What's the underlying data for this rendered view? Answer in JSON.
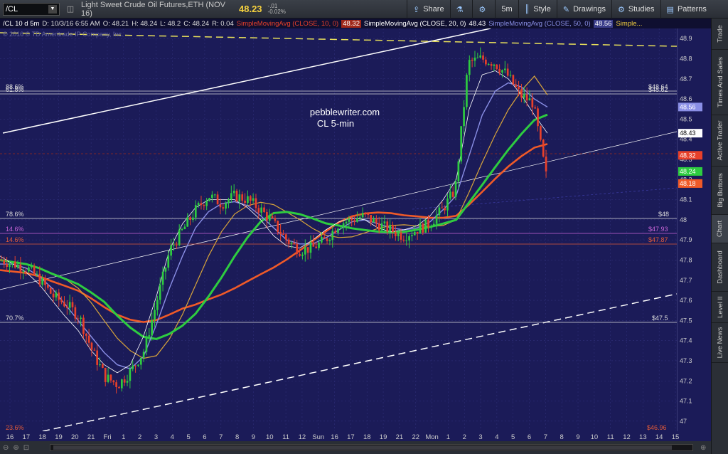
{
  "toolbar": {
    "symbol": "/CL",
    "instrument": "Light Sweet Crude Oil Futures,ETH (NOV 16)",
    "last": "48.23",
    "change": "-.01",
    "change_pct": "-0.02%",
    "share": "Share",
    "timeframe": "5m",
    "style": "Style",
    "drawings": "Drawings",
    "studies": "Studies",
    "patterns": "Patterns"
  },
  "infobar": {
    "symbol": "/CL 10 d 5m",
    "date": "D: 10/3/16 6:55 AM",
    "open": "O: 48.21",
    "high": "H: 48.24",
    "low": "L: 48.2",
    "close": "C: 48.24",
    "range": "R: 0.04",
    "sma10": "SimpleMovingAvg (CLOSE, 10, 0)",
    "sma10_val": "48.32",
    "sma20": "SimpleMovingAvg (CLOSE, 20, 0)",
    "sma20_val": "48.43",
    "sma50": "SimpleMovingAvg (CLOSE, 50, 0)",
    "sma50_val": "48.56",
    "more": "Simple..."
  },
  "chart": {
    "copyright": "© 2016 © TD Ameritrade IP Company, Inc.",
    "watermark_line1": "pebblewriter.com",
    "watermark_line2": "CL 5-min",
    "fib_labels": [
      "88.6%",
      "61.8%",
      "78.6%",
      "14.6%",
      "14.6%",
      "70.7%",
      "23.6%"
    ],
    "level_labels": [
      "$48.64",
      "$48.62",
      "$48",
      "$47.93",
      "$47.87",
      "$47.5",
      "$46.96"
    ]
  },
  "chart_data": {
    "type": "line",
    "title": "",
    "ylim": [
      46.95,
      48.95
    ],
    "price_ticks": [
      "48.9",
      "48.8",
      "48.7",
      "48.6",
      "48.5",
      "48.4",
      "48.3",
      "48.2",
      "48.1",
      "48",
      "47.9",
      "47.8",
      "47.7",
      "47.6",
      "47.5",
      "47.4",
      "47.3",
      "47.2",
      "47.1",
      "47"
    ],
    "time_ticks": [
      "16",
      "17",
      "18",
      "19",
      "20",
      "21",
      "Fri",
      "1",
      "2",
      "3",
      "4",
      "5",
      "6",
      "7",
      "8",
      "9",
      "10",
      "11",
      "12",
      "Sun",
      "16",
      "17",
      "18",
      "19",
      "21",
      "22",
      "Mon",
      "1",
      "2",
      "3",
      "4",
      "5",
      "6",
      "7",
      "8",
      "9",
      "10",
      "11",
      "12",
      "13",
      "14",
      "15"
    ],
    "price_flags": [
      {
        "value": "48.56",
        "color": "#8a8fe6"
      },
      {
        "value": "48.43",
        "color": "#ffffff"
      },
      {
        "value": "48.32",
        "color": "#e8402a"
      },
      {
        "value": "48.24",
        "color": "#2ecc40"
      },
      {
        "value": "48.18",
        "color": "#f05a28"
      }
    ],
    "price": [
      47.8,
      47.78,
      47.76,
      47.7,
      47.62,
      47.58,
      47.52,
      47.35,
      47.22,
      47.18,
      47.25,
      47.35,
      47.6,
      47.85,
      47.95,
      48.05,
      48.12,
      48.08,
      48.12,
      48.1,
      48.05,
      47.98,
      47.9,
      47.85,
      47.86,
      47.9,
      47.98,
      48.0,
      48.02,
      47.98,
      47.95,
      47.92,
      47.95,
      47.98,
      48.05,
      48.15,
      48.78,
      48.8,
      48.78,
      48.72,
      48.62,
      48.58,
      48.22
    ],
    "series": [
      {
        "name": "SimpleMovingAvg (CLOSE, 10, 0)",
        "color": "#ffffff",
        "values": [
          47.82,
          47.78,
          47.74,
          47.68,
          47.6,
          47.52,
          47.45,
          47.35,
          47.28,
          47.24,
          47.28,
          47.42,
          47.62,
          47.85,
          47.98,
          48.06,
          48.1,
          48.1,
          48.1,
          48.06,
          48.0,
          47.92,
          47.87,
          47.86,
          47.9,
          47.95,
          47.99,
          48.01,
          48.0,
          47.96,
          47.94,
          47.95,
          47.97,
          48.02,
          48.1,
          48.2,
          48.55,
          48.72,
          48.74,
          48.7,
          48.62,
          48.52,
          48.43
        ]
      },
      {
        "name": "SimpleMovingAvg (CLOSE, 20, 0)",
        "color": "#8a8fe6",
        "values": [
          47.78,
          47.78,
          47.76,
          47.72,
          47.66,
          47.58,
          47.5,
          47.42,
          47.34,
          47.28,
          47.26,
          47.32,
          47.48,
          47.66,
          47.82,
          47.96,
          48.04,
          48.08,
          48.09,
          48.07,
          48.02,
          47.96,
          47.9,
          47.88,
          47.88,
          47.91,
          47.95,
          47.99,
          48.0,
          47.98,
          47.96,
          47.95,
          47.96,
          47.99,
          48.05,
          48.12,
          48.32,
          48.52,
          48.64,
          48.68,
          48.66,
          48.6,
          48.56
        ]
      }
    ]
  }
}
